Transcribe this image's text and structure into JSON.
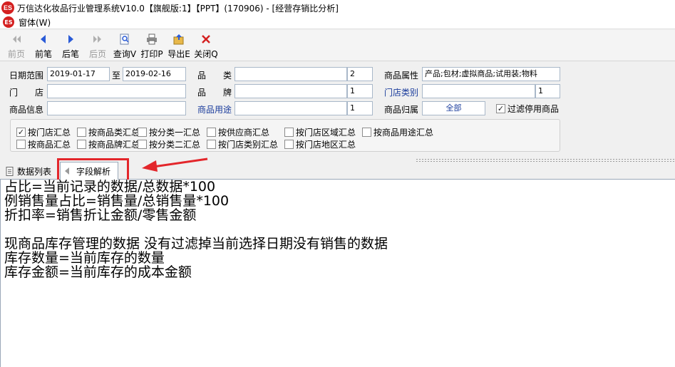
{
  "window": {
    "title": "万信达化妆品行业管理系统V10.0【旗舰版:1】【PPT】(170906) - [经营存销比分析]",
    "logo_text": "ES"
  },
  "menu": {
    "items": [
      "窗体(W)"
    ]
  },
  "toolbar": {
    "buttons": [
      {
        "label": "前页",
        "icon": "double-arrow-left-icon",
        "enabled": false
      },
      {
        "label": "前笔",
        "icon": "arrow-left-icon",
        "enabled": true
      },
      {
        "label": "后笔",
        "icon": "arrow-right-icon",
        "enabled": true
      },
      {
        "label": "后页",
        "icon": "double-arrow-right-icon",
        "enabled": false
      },
      {
        "label": "查询V",
        "icon": "search-icon",
        "enabled": true
      },
      {
        "label": "打印P",
        "icon": "printer-icon",
        "enabled": true
      },
      {
        "label": "导出E",
        "icon": "export-icon",
        "enabled": true
      },
      {
        "label": "关闭Q",
        "icon": "close-icon",
        "enabled": true
      }
    ]
  },
  "filters": {
    "date_range_label": "日期范围",
    "date_from": "2019-01-17",
    "date_to_label": "至",
    "date_to": "2019-02-16",
    "store_label": "门　　店",
    "store_value": "",
    "product_info_label": "商品信息",
    "product_info_value": "",
    "category_label": "品　　类",
    "category_value": "",
    "category_level": "2",
    "brand_label": "品　　牌",
    "brand_value": "",
    "brand_level": "1",
    "product_usage_label": "商品用途",
    "product_usage_value": "",
    "product_usage_level": "1",
    "product_attr_label": "商品属性",
    "product_attr_value": "产品;包材;虚拟商品;试用装;物料",
    "store_type_label": "门店类别",
    "store_type_value": "",
    "store_type_level": "1",
    "product_owner_label": "商品归属",
    "product_owner_value": "全部",
    "filter_disabled_label": "过滤停用商品",
    "filter_disabled_checked": true
  },
  "summary_options": [
    {
      "label": "按门店汇总",
      "checked": true
    },
    {
      "label": "按商品类汇总",
      "checked": false
    },
    {
      "label": "按分类一汇总",
      "checked": false
    },
    {
      "label": "按供应商汇总",
      "checked": false
    },
    {
      "label": "按门店区域汇总",
      "checked": false
    },
    {
      "label": "按商品用途汇总",
      "checked": false
    },
    {
      "label": "按商品汇总",
      "checked": false
    },
    {
      "label": "按商品牌汇总",
      "checked": false
    },
    {
      "label": "按分类二汇总",
      "checked": false
    },
    {
      "label": "按门店类别汇总",
      "checked": false
    },
    {
      "label": "按门店地区汇总",
      "checked": false
    }
  ],
  "tabs": [
    {
      "label": "数据列表",
      "active": false
    },
    {
      "label": "字段解析",
      "active": true
    }
  ],
  "content_lines": [
    "占比=当前记录的数据/总数据*100",
    "例销售量占比=销售量/总销售量*100",
    "折扣率=销售折让金额/零售金额",
    "",
    "现商品库存管理的数据 没有过滤掉当前选择日期没有销售的数据",
    "库存数量=当前库存的数量",
    "库存金额=当前库存的成本金额"
  ],
  "colors": {
    "highlight": "#e3262b",
    "logo": "#d42020",
    "link_blue": "#1a3c9c"
  }
}
